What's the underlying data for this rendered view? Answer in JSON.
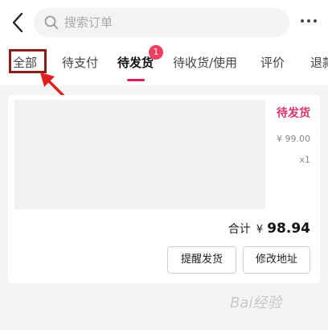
{
  "header": {
    "search_placeholder": "搜索订单",
    "back_icon": "chevron-left-icon",
    "more_icon": "more-dots-icon"
  },
  "tabs": [
    {
      "label": "全部"
    },
    {
      "label": "待支付"
    },
    {
      "label": "待发货",
      "badge": "1",
      "active": true
    },
    {
      "label": "待收货/使用"
    },
    {
      "label": "评价"
    },
    {
      "label": "退款"
    }
  ],
  "order": {
    "status": "待发货",
    "price": "¥ 99.00",
    "quantity": "x1",
    "total_label": "合计",
    "total_currency": "¥",
    "total_value": "98.94",
    "buttons": {
      "remind": "提醒发货",
      "change_address": "修改地址"
    }
  },
  "colors": {
    "accent": "#e2175a",
    "badge": "#ef3f5f",
    "annotation": "#8b1d1d",
    "arrow": "#e02020"
  },
  "watermark": "Bai经验"
}
